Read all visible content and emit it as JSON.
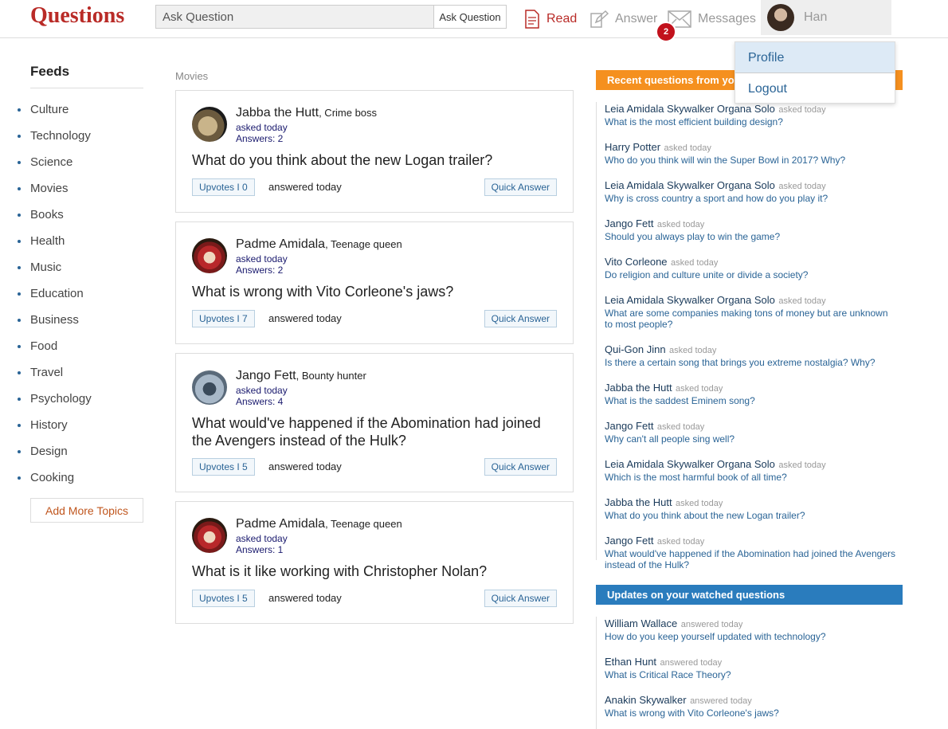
{
  "header": {
    "brand": "Questions",
    "search_placeholder": "Ask Question",
    "ask_button": "Ask Question",
    "nav": {
      "read": "Read",
      "answer": "Answer",
      "messages": "Messages"
    },
    "messages_badge": "2",
    "user_name": "Han"
  },
  "user_menu": {
    "profile": "Profile",
    "logout": "Logout"
  },
  "sidebar": {
    "title": "Feeds",
    "topics": [
      "Culture",
      "Technology",
      "Science",
      "Movies",
      "Books",
      "Health",
      "Music",
      "Education",
      "Business",
      "Food",
      "Travel",
      "Psychology",
      "History",
      "Design",
      "Cooking"
    ],
    "add_topics": "Add More Topics"
  },
  "feed": {
    "label": "Movies",
    "cards": [
      {
        "author": "Jabba the Hutt",
        "role": ", Crime boss",
        "asked": "asked today",
        "answers": "Answers: 2",
        "question": "What do you think about the new Logan trailer?",
        "upvotes": "Upvotes I 0",
        "answered": "answered today",
        "quick": "Quick Answer"
      },
      {
        "author": "Padme Amidala",
        "role": ", Teenage queen",
        "asked": "asked today",
        "answers": "Answers: 2",
        "question": "What is wrong with Vito Corleone's jaws?",
        "upvotes": "Upvotes I 7",
        "answered": "answered today",
        "quick": "Quick Answer"
      },
      {
        "author": "Jango Fett",
        "role": ", Bounty hunter",
        "asked": "asked today",
        "answers": "Answers: 4",
        "question": "What would've happened if the Abomination had joined the Avengers instead of the Hulk?",
        "upvotes": "Upvotes I 5",
        "answered": "answered today",
        "quick": "Quick Answer"
      },
      {
        "author": "Padme Amidala",
        "role": ", Teenage queen",
        "asked": "asked today",
        "answers": "Answers: 1",
        "question": "What is it like working with Christopher Nolan?",
        "upvotes": "Upvotes I 5",
        "answered": "answered today",
        "quick": "Quick Answer"
      }
    ]
  },
  "recent": {
    "title": "Recent questions from your f",
    "items": [
      {
        "name": "Leia Amidala Skywalker Organa Solo",
        "when": "asked today",
        "q": "What is the most efficient building design?"
      },
      {
        "name": "Harry Potter",
        "when": "asked today",
        "q": "Who do you think will win the Super Bowl in 2017? Why?"
      },
      {
        "name": "Leia Amidala Skywalker Organa Solo",
        "when": "asked today",
        "q": "Why is cross country a sport and how do you play it?"
      },
      {
        "name": "Jango Fett",
        "when": "asked today",
        "q": "Should you always play to win the game?"
      },
      {
        "name": "Vito Corleone",
        "when": "asked today",
        "q": "Do religion and culture unite or divide a society?"
      },
      {
        "name": "Leia Amidala Skywalker Organa Solo",
        "when": "asked today",
        "q": "What are some companies making tons of money but are unknown to most people?"
      },
      {
        "name": "Qui-Gon Jinn",
        "when": "asked today",
        "q": "Is there a certain song that brings you extreme nostalgia? Why?"
      },
      {
        "name": "Jabba the Hutt",
        "when": "asked today",
        "q": "What is the saddest Eminem song?"
      },
      {
        "name": "Jango Fett",
        "when": "asked today",
        "q": "Why can't all people sing well?"
      },
      {
        "name": "Leia Amidala Skywalker Organa Solo",
        "when": "asked today",
        "q": "Which is the most harmful book of all time?"
      },
      {
        "name": "Jabba the Hutt",
        "when": "asked today",
        "q": "What do you think about the new Logan trailer?"
      },
      {
        "name": "Jango Fett",
        "when": "asked today",
        "q": "What would've happened if the Abomination had joined the Avengers instead of the Hulk?"
      }
    ]
  },
  "watched": {
    "title": "Updates on your watched questions",
    "items": [
      {
        "name": "William Wallace",
        "when": "answered today",
        "q": "How do you keep yourself updated with technology?"
      },
      {
        "name": "Ethan Hunt",
        "when": "answered today",
        "q": "What is Critical Race Theory?"
      },
      {
        "name": "Anakin Skywalker",
        "when": "answered today",
        "q": "What is wrong with Vito Corleone's jaws?"
      }
    ]
  }
}
